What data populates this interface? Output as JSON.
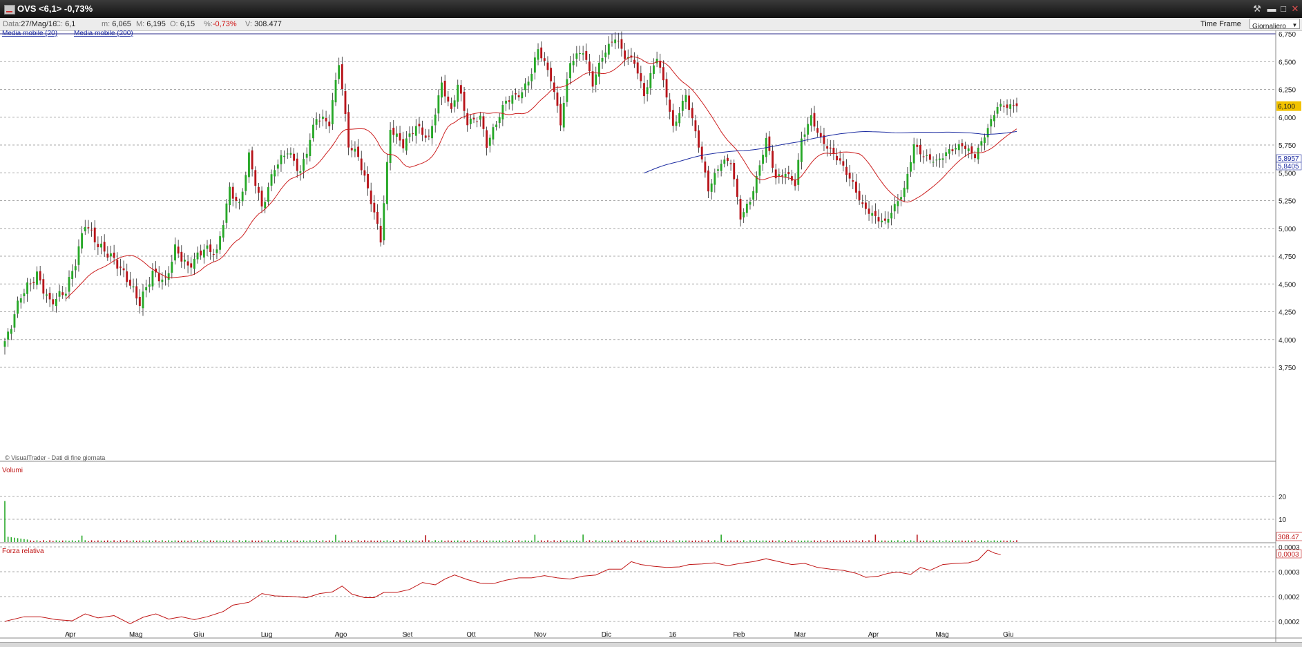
{
  "window": {
    "title": "OVS <6,1> -0,73%"
  },
  "infobar": {
    "date_label": "Data:",
    "date_value": "27/Mag/16",
    "close_label": "C:",
    "close_value": "6,1",
    "min_label": "m:",
    "min_value": "6,065",
    "max_label": "M:",
    "max_value": "6,195",
    "open_label": "O:",
    "open_value": "6,15",
    "pct_label": "%:",
    "pct_value": "-0,73%",
    "vol_label": "V:",
    "vol_value": "308.477",
    "timeframe_label": "Time Frame",
    "timeframe_value": "Giornaliero"
  },
  "colors": {
    "up": "#27a828",
    "down": "#b8141a",
    "ma20": "#cc2020",
    "ma200": "#1a2aa0",
    "rs": "#c01515",
    "grid": "#aaaaaa",
    "current_label_bg": "#f2c200"
  },
  "chart_data": {
    "type": "candlestick",
    "overlays": [
      "Media mobile (20)",
      "Media mobile (200)"
    ],
    "copyright": "© VisualTrader - Dati di fine giornata",
    "price_ylim": [
      3.6,
      6.75
    ],
    "price_ticks": [
      "6,750",
      "6,500",
      "6,250",
      "6,000",
      "5,750",
      "5,500",
      "5,250",
      "5,000",
      "4,750",
      "4,500",
      "4,250",
      "4,000",
      "3,750"
    ],
    "price_tick_values": [
      6.75,
      6.5,
      6.25,
      6.0,
      5.75,
      5.5,
      5.25,
      5.0,
      4.75,
      4.5,
      4.25,
      4.0,
      3.75
    ],
    "current_price_label": "6,100",
    "ma20_label": "5,8957",
    "ma200_label": "5,8405",
    "months": [
      "Apr",
      "Mag",
      "Giu",
      "Lug",
      "Ago",
      "Set",
      "Ott",
      "Nov",
      "Dic",
      "16",
      "Feb",
      "Mar",
      "Apr",
      "Mag",
      "Giu"
    ],
    "month_start_index": [
      20,
      40,
      60,
      81,
      104,
      125,
      145,
      166,
      187,
      208,
      228,
      247,
      270,
      291,
      312
    ],
    "total_sessions": 316,
    "anchors": [
      [
        0,
        3.96
      ],
      [
        5,
        4.4
      ],
      [
        10,
        4.58
      ],
      [
        14,
        4.33
      ],
      [
        19,
        4.44
      ],
      [
        22,
        4.7
      ],
      [
        25,
        5.05
      ],
      [
        29,
        4.85
      ],
      [
        34,
        4.72
      ],
      [
        38,
        4.55
      ],
      [
        42,
        4.33
      ],
      [
        46,
        4.6
      ],
      [
        50,
        4.52
      ],
      [
        53,
        4.82
      ],
      [
        57,
        4.65
      ],
      [
        62,
        4.82
      ],
      [
        66,
        4.78
      ],
      [
        70,
        5.35
      ],
      [
        73,
        5.2
      ],
      [
        76,
        5.65
      ],
      [
        80,
        5.18
      ],
      [
        84,
        5.55
      ],
      [
        88,
        5.7
      ],
      [
        92,
        5.5
      ],
      [
        97,
        6.0
      ],
      [
        101,
        5.95
      ],
      [
        104,
        6.5
      ],
      [
        107,
        5.75
      ],
      [
        110,
        5.65
      ],
      [
        114,
        5.25
      ],
      [
        117,
        4.9
      ],
      [
        120,
        5.9
      ],
      [
        124,
        5.75
      ],
      [
        128,
        5.92
      ],
      [
        132,
        5.8
      ],
      [
        136,
        6.3
      ],
      [
        139,
        6.05
      ],
      [
        141,
        6.3
      ],
      [
        144,
        5.95
      ],
      [
        148,
        6.0
      ],
      [
        150,
        5.75
      ],
      [
        153,
        5.95
      ],
      [
        156,
        6.15
      ],
      [
        161,
        6.22
      ],
      [
        164,
        6.4
      ],
      [
        166,
        6.62
      ],
      [
        170,
        6.35
      ],
      [
        173,
        5.95
      ],
      [
        176,
        6.5
      ],
      [
        180,
        6.6
      ],
      [
        183,
        6.3
      ],
      [
        186,
        6.55
      ],
      [
        190,
        6.72
      ],
      [
        193,
        6.55
      ],
      [
        196,
        6.5
      ],
      [
        199,
        6.2
      ],
      [
        203,
        6.55
      ],
      [
        206,
        6.2
      ],
      [
        208,
        5.9
      ],
      [
        212,
        6.2
      ],
      [
        216,
        5.75
      ],
      [
        219,
        5.35
      ],
      [
        223,
        5.6
      ],
      [
        226,
        5.6
      ],
      [
        229,
        5.1
      ],
      [
        232,
        5.25
      ],
      [
        234,
        5.45
      ],
      [
        237,
        5.8
      ],
      [
        240,
        5.45
      ],
      [
        243,
        5.5
      ],
      [
        246,
        5.4
      ],
      [
        248,
        5.8
      ],
      [
        251,
        6.0
      ],
      [
        254,
        5.8
      ],
      [
        257,
        5.7
      ],
      [
        260,
        5.6
      ],
      [
        264,
        5.4
      ],
      [
        267,
        5.2
      ],
      [
        271,
        5.1
      ],
      [
        274,
        5.05
      ],
      [
        277,
        5.2
      ],
      [
        280,
        5.35
      ],
      [
        283,
        5.75
      ],
      [
        286,
        5.65
      ],
      [
        290,
        5.6
      ],
      [
        294,
        5.7
      ],
      [
        298,
        5.75
      ],
      [
        302,
        5.65
      ],
      [
        306,
        5.9
      ],
      [
        309,
        6.1
      ],
      [
        311,
        6.1
      ]
    ],
    "volume": {
      "label": "Volumi",
      "ylim": [
        0,
        20
      ],
      "ticks": [
        "20",
        "10"
      ],
      "tick_values": [
        20,
        10
      ],
      "last_label": "308.47"
    },
    "relative_strength": {
      "label": "Forza relativa",
      "ticks": [
        "0,0003",
        "0,0003",
        "0,0002",
        "0,0002"
      ],
      "last_label": "0,0003",
      "normalized_series": [
        [
          0,
          0.12
        ],
        [
          6,
          0.2
        ],
        [
          11,
          0.2
        ],
        [
          16,
          0.15
        ],
        [
          21,
          0.13
        ],
        [
          25,
          0.25
        ],
        [
          29,
          0.18
        ],
        [
          34,
          0.22
        ],
        [
          39,
          0.08
        ],
        [
          43,
          0.19
        ],
        [
          47,
          0.25
        ],
        [
          51,
          0.16
        ],
        [
          55,
          0.2
        ],
        [
          59,
          0.15
        ],
        [
          63,
          0.2
        ],
        [
          68,
          0.29
        ],
        [
          71,
          0.4
        ],
        [
          76,
          0.45
        ],
        [
          80,
          0.6
        ],
        [
          84,
          0.56
        ],
        [
          89,
          0.55
        ],
        [
          94,
          0.53
        ],
        [
          98,
          0.6
        ],
        [
          102,
          0.63
        ],
        [
          105,
          0.73
        ],
        [
          108,
          0.59
        ],
        [
          112,
          0.53
        ],
        [
          115,
          0.53
        ],
        [
          118,
          0.62
        ],
        [
          122,
          0.62
        ],
        [
          126,
          0.67
        ],
        [
          130,
          0.79
        ],
        [
          134,
          0.75
        ],
        [
          137,
          0.85
        ],
        [
          140,
          0.92
        ],
        [
          144,
          0.84
        ],
        [
          148,
          0.78
        ],
        [
          152,
          0.77
        ],
        [
          156,
          0.83
        ],
        [
          160,
          0.87
        ],
        [
          164,
          0.87
        ],
        [
          168,
          0.91
        ],
        [
          172,
          0.87
        ],
        [
          176,
          0.85
        ],
        [
          180,
          0.9
        ],
        [
          184,
          0.92
        ],
        [
          188,
          1.02
        ],
        [
          192,
          1.02
        ],
        [
          195,
          1.15
        ],
        [
          198,
          1.1
        ],
        [
          202,
          1.07
        ],
        [
          206,
          1.05
        ],
        [
          210,
          1.06
        ],
        [
          213,
          1.1
        ],
        [
          217,
          1.11
        ],
        [
          221,
          1.13
        ],
        [
          225,
          1.08
        ],
        [
          229,
          1.12
        ],
        [
          233,
          1.15
        ],
        [
          237,
          1.2
        ],
        [
          241,
          1.15
        ],
        [
          245,
          1.1
        ],
        [
          249,
          1.12
        ],
        [
          253,
          1.05
        ],
        [
          257,
          1.02
        ],
        [
          261,
          1.0
        ],
        [
          265,
          0.95
        ],
        [
          268,
          0.88
        ],
        [
          272,
          0.9
        ],
        [
          275,
          0.95
        ],
        [
          278,
          0.97
        ],
        [
          282,
          0.93
        ],
        [
          285,
          1.05
        ],
        [
          288,
          1.0
        ],
        [
          292,
          1.1
        ],
        [
          296,
          1.12
        ],
        [
          300,
          1.13
        ],
        [
          303,
          1.18
        ],
        [
          306,
          1.35
        ],
        [
          308,
          1.3
        ],
        [
          310,
          1.27
        ]
      ]
    }
  }
}
